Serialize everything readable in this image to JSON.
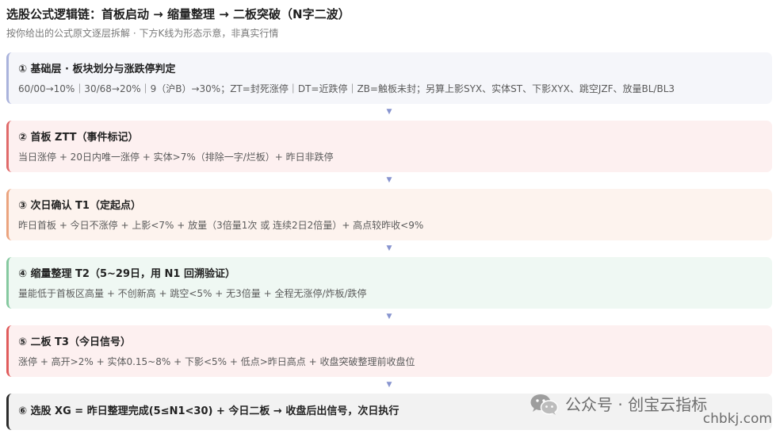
{
  "header": {
    "title": "选股公式逻辑链：首板启动 → 缩量整理 → 二板突破（N字二波）",
    "subtitle": "按你给出的公式原文逐层拆解 · 下方K线为形态示意，非真实行情"
  },
  "arrow_glyph": "▼",
  "colors": {
    "arrow": "#8794cf",
    "title_text": "#222222",
    "body_text": "#5b5b5b"
  },
  "steps": [
    {
      "title": "① 基础层 · 板块划分与涨跌停判定",
      "body": "60/00→10%｜30/68→20%｜9（沪B）→30%；ZT=封死涨停｜DT=近跌停｜ZB=触板未封；另算上影SYX、实体ST、下影XYX、跳空JZF、放量BL/BL3",
      "accent": "#aab3dc",
      "background": "#f5f6fa"
    },
    {
      "title": "② 首板 ZTT（事件标记）",
      "body": "当日涨停 + 20日内唯一涨停 + 实体>7%（排除一字/烂板）+ 昨日非跌停",
      "accent": "#e06a6a",
      "background": "#fdf0f0"
    },
    {
      "title": "③ 次日确认 T1（定起点）",
      "body": "昨日首板 + 今日不涨停 + 上影<7% + 放量（3倍量1次 或 连续2日2倍量）+ 高点较昨收<9%",
      "accent": "#eba47f",
      "background": "#fdf3ee"
    },
    {
      "title": "④ 缩量整理 T2（5~29日，用 N1 回溯验证）",
      "body": "量能低于首板区高量 + 不创新高 + 跳空<5% + 无3倍量 + 全程无涨停/炸板/跌停",
      "accent": "#86c9a0",
      "background": "#eff8f3"
    },
    {
      "title": "⑤ 二板 T3（今日信号）",
      "body": "涨停 + 高开>2% + 实体0.15~8% + 下影<5% + 低点>昨日高点 + 收盘突破整理前收盘位",
      "accent": "#e05c5c",
      "background": "#fdf0f0"
    },
    {
      "title": "⑥ 选股 XG = 昨日整理完成(5≤N1<30) + 今日二板 → 收盘后出信号，次日执行",
      "accent": "#2b2b2b",
      "background": "#f2f2f2"
    }
  ],
  "watermark": {
    "icon": "wechat-icon",
    "line1": "公众号 · 创宝云指标",
    "line2": "chbkj.com"
  }
}
